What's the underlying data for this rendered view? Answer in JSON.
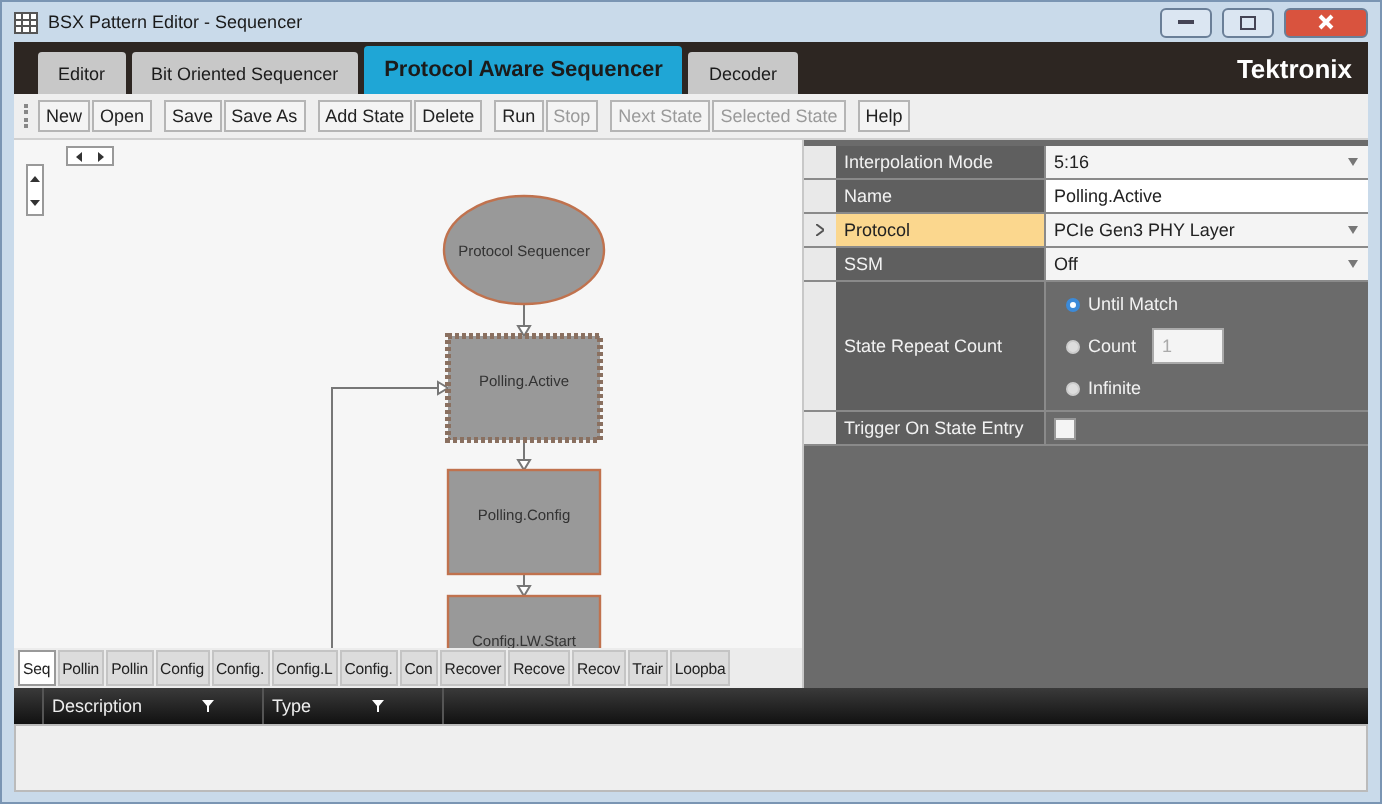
{
  "window": {
    "title": "BSX Pattern Editor - Sequencer"
  },
  "tabs": [
    {
      "label": "Editor",
      "selected": false
    },
    {
      "label": "Bit Oriented Sequencer",
      "selected": false
    },
    {
      "label": "Protocol Aware Sequencer",
      "selected": true
    },
    {
      "label": "Decoder",
      "selected": false
    }
  ],
  "brand": "Tektronix",
  "toolbar": {
    "groups": [
      [
        {
          "label": "New",
          "disabled": false
        },
        {
          "label": "Open",
          "disabled": false
        }
      ],
      [
        {
          "label": "Save",
          "disabled": false
        },
        {
          "label": "Save As",
          "disabled": false
        }
      ],
      [
        {
          "label": "Add State",
          "disabled": false
        },
        {
          "label": "Delete",
          "disabled": false
        }
      ],
      [
        {
          "label": "Run",
          "disabled": false
        },
        {
          "label": "Stop",
          "disabled": true
        }
      ],
      [
        {
          "label": "Next State",
          "disabled": true
        },
        {
          "label": "Selected State",
          "disabled": true
        }
      ]
    ],
    "help": "Help"
  },
  "diagram": {
    "nodes": [
      {
        "label": "Protocol Sequencer",
        "kind": "ellipse",
        "selected": false
      },
      {
        "label": "Polling.Active",
        "kind": "box",
        "selected": true
      },
      {
        "label": "Polling.Config",
        "kind": "box",
        "selected": false
      },
      {
        "label": "Config.LW.Start",
        "kind": "box",
        "selected": false
      }
    ]
  },
  "state_tabs": [
    {
      "label": "Seq",
      "selected": true
    },
    {
      "label": "Pollin",
      "selected": false
    },
    {
      "label": "Pollin",
      "selected": false
    },
    {
      "label": "Config",
      "selected": false
    },
    {
      "label": "Config.",
      "selected": false
    },
    {
      "label": "Config.L",
      "selected": false
    },
    {
      "label": "Config.",
      "selected": false
    },
    {
      "label": "Con",
      "selected": false
    },
    {
      "label": "Recover",
      "selected": false
    },
    {
      "label": "Recove",
      "selected": false
    },
    {
      "label": "Recov",
      "selected": false
    },
    {
      "label": "Trair",
      "selected": false
    },
    {
      "label": "Loopba",
      "selected": false
    }
  ],
  "properties": [
    {
      "label": "Interpolation Mode",
      "kind": "dropdown",
      "value": "5:16",
      "selected": false
    },
    {
      "label": "Name",
      "kind": "text",
      "value": "Polling.Active",
      "selected": false
    },
    {
      "label": "Protocol",
      "kind": "dropdown",
      "value": "PCIe Gen3 PHY Layer",
      "selected": true
    },
    {
      "label": "SSM",
      "kind": "dropdown",
      "value": "Off",
      "selected": false
    },
    {
      "label": "State Repeat Count",
      "kind": "radio",
      "options": [
        {
          "label": "Until Match",
          "selected": true
        },
        {
          "label": "Count",
          "selected": false,
          "field": "1"
        },
        {
          "label": "Infinite",
          "selected": false
        }
      ]
    },
    {
      "label": "Trigger On State Entry",
      "kind": "checkbox",
      "checked": false
    }
  ],
  "grid": {
    "columns": [
      "Description",
      "Type"
    ]
  }
}
